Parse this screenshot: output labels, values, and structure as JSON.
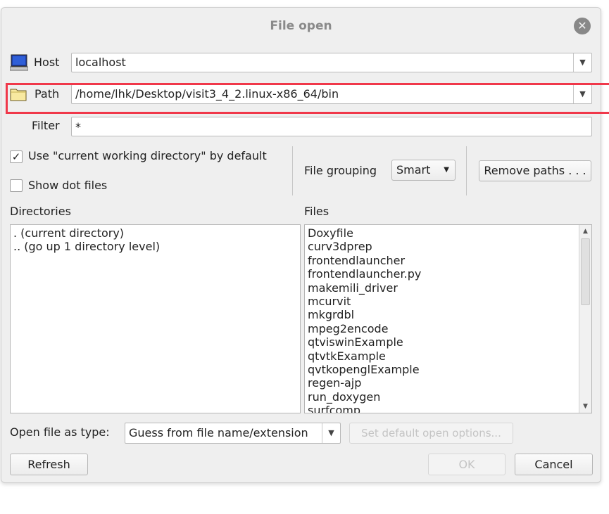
{
  "dialog": {
    "title": "File open",
    "close_glyph": "✕"
  },
  "host": {
    "label": "Host",
    "value": "localhost",
    "icon": "monitor-icon"
  },
  "path": {
    "label": "Path",
    "value": "/home/lhk/Desktop/visit3_4_2.linux-x86_64/bin",
    "icon": "folder-icon"
  },
  "filter": {
    "label": "Filter",
    "value": "*"
  },
  "options": {
    "use_cwd_label": "Use \"current working directory\" by default",
    "use_cwd_checked": true,
    "show_dot_label": "Show dot files",
    "show_dot_checked": false,
    "check_glyph": "✓",
    "file_grouping_label": "File grouping",
    "file_grouping_value": "Smart",
    "remove_paths_label": "Remove paths . . ."
  },
  "directories": {
    "header": "Directories",
    "items": [
      ". (current directory)",
      ".. (go up 1 directory level)"
    ]
  },
  "files": {
    "header": "Files",
    "items": [
      "Doxyfile",
      "curv3dprep",
      "frontendlauncher",
      "frontendlauncher.py",
      "makemili_driver",
      "mcurvit",
      "mkgrdbl",
      "mpeg2encode",
      "qtviswinExample",
      "qtvtkExample",
      "qvtkopenglExample",
      "regen-ajp",
      "run_doxygen",
      "surfcomp"
    ]
  },
  "bottom": {
    "open_as_label": "Open file as type:",
    "open_as_value": "Guess from file name/extension",
    "set_default_label": "Set default open options...",
    "refresh_label": "Refresh",
    "ok_label": "OK",
    "cancel_label": "Cancel"
  },
  "colors": {
    "highlight": "#f0384a",
    "dialog_bg": "#efefef"
  }
}
